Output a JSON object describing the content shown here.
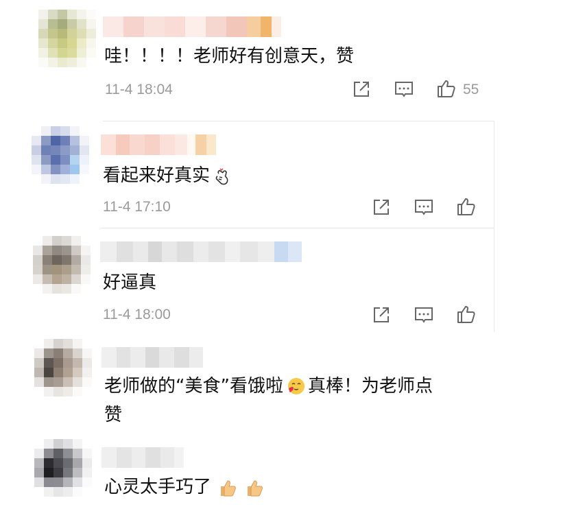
{
  "comments": [
    {
      "text": "哇！！！！老师好有创意天，赞",
      "time": "11-4 18:04",
      "likes": "55"
    },
    {
      "text": "看起来好真实",
      "emoji": "finger-heart-emoji",
      "time": "11-4 17:10"
    },
    {
      "text": "好逼真",
      "time": "11-4 18:00"
    },
    {
      "text_line1": "老师做的“美食”看饿啦",
      "emoji": "heart-face-emoji",
      "text_line1b": "真棒！为老师点",
      "text_line2": "赞"
    },
    {
      "text": "心灵太手巧了",
      "emoji": "thumbs-up-emoji"
    }
  ],
  "icons": {
    "share": "share-icon",
    "reply": "comment-icon",
    "like": "thumbs-up-icon"
  },
  "colors": {
    "text": "#111111",
    "meta": "#9a9a9a",
    "divider": "#e6e6e6"
  }
}
